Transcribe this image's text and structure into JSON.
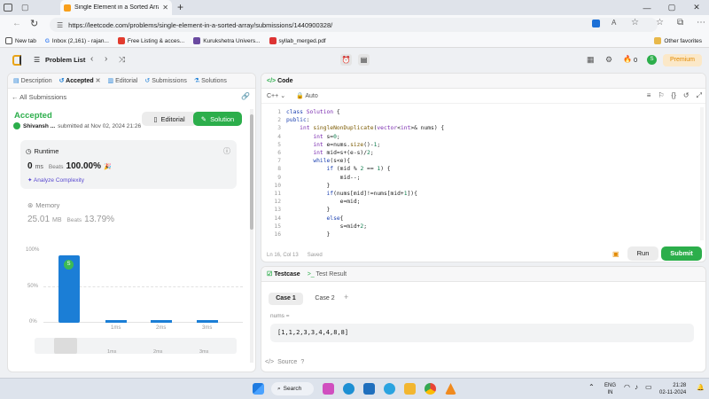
{
  "browser": {
    "tab_title": "Single Element in a Sorted Array",
    "url": "https://leetcode.com/problems/single-element-in-a-sorted-array/submissions/1440900328/",
    "bookmarks": [
      "New tab",
      "Inbox (2,161) - rajan...",
      "Free Listing & acces...",
      "Kurukshetra Univers...",
      "syllab_merged.pdf"
    ],
    "other_favorites": "Other favorites"
  },
  "topbar": {
    "problem_list": "Problem List",
    "fire_count": "0",
    "premium": "Premium",
    "avatar_letter": "S"
  },
  "left_tabs": [
    "Description",
    "Accepted",
    "Editorial",
    "Submissions",
    "Solutions"
  ],
  "submission": {
    "back": "All Submissions",
    "status": "Accepted",
    "user": "Shivansh ...",
    "submitted": "submitted at Nov 02, 2024 21:26",
    "editorial_btn": "Editorial",
    "solution_btn": "Solution",
    "runtime_label": "Runtime",
    "runtime_value": "0",
    "runtime_unit": "ms",
    "beats_label": "Beats",
    "beats_runtime": "100.00%",
    "analyze": "Analyze Complexity",
    "memory_label": "Memory",
    "memory_value": "25.01",
    "memory_unit": "MB",
    "beats_memory": "13.79%"
  },
  "chart": {
    "y_ticks": [
      "100%",
      "50%",
      "0%"
    ],
    "x_ticks": [
      "1ms",
      "2ms",
      "3ms"
    ],
    "mini_ticks": [
      "1ms",
      "2ms",
      "3ms"
    ],
    "avatar": "S"
  },
  "code_panel": {
    "title": "Code",
    "lang": "C++",
    "mode": "Auto",
    "status": "Ln 16, Col 13",
    "saved": "Saved",
    "run": "Run",
    "submit": "Submit"
  },
  "code_lines": [
    "class Solution {",
    "public:",
    "    int singleNonDuplicate(vector<int>& nums) {",
    "        int s=0;",
    "        int e=nums.size()-1;",
    "        int mid=s+(e-s)/2;",
    "        while(s<e){",
    "            if (mid % 2 == 1) {",
    "                mid--;",
    "            }",
    "            if(nums[mid]!=nums[mid+1]){",
    "                e=mid;",
    "            }",
    "            else{",
    "                s=mid+2;",
    "            }"
  ],
  "testcase": {
    "tab1": "Testcase",
    "tab2": "Test Result",
    "case1": "Case 1",
    "case2": "Case 2",
    "var_label": "nums =",
    "value": "[1,1,2,3,3,4,4,8,8]",
    "source": "Source"
  },
  "taskbar": {
    "search": "Search",
    "lang1": "ENG",
    "lang2": "IN",
    "time": "21:28",
    "date": "02-11-2024"
  }
}
